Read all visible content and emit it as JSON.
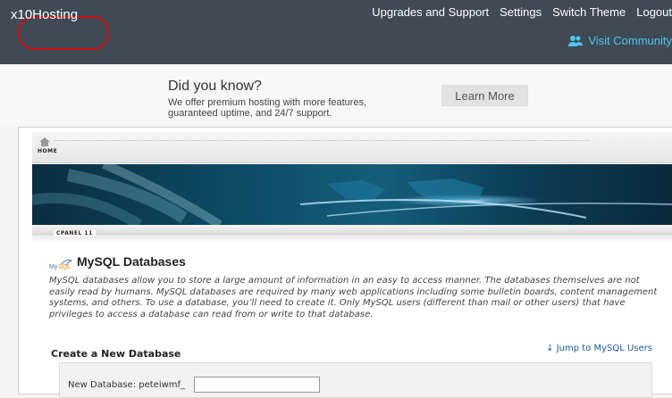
{
  "header": {
    "logo": "x10Hosting",
    "nav": [
      "Upgrades and Support",
      "Settings",
      "Switch Theme",
      "Logout"
    ],
    "community": "Visit Community",
    "community_icon": "people-icon"
  },
  "promo": {
    "title": "Did you know?",
    "text": "We offer premium hosting with more features, guaranteed uptime, and 24/7 support.",
    "button": "Learn More"
  },
  "breadcrumb": {
    "home": "HOME"
  },
  "section_label": "CPANEL 11",
  "mysql": {
    "title": "MySQL Databases",
    "description": "MySQL databases allow you to store a large amount of information in an easy to access manner. The databases themselves are not easily read by humans. MySQL databases are required by many web applications including some bulletin boards, content management systems, and others. To use a database, you’ll need to create it. Only MySQL users (different than mail or other users) that have privileges to access a database can read from or write to that database.",
    "jump": "↓ Jump to MySQL Users",
    "create_title": "Create a New Database",
    "new_db_label": "New Database: peteiwmf_",
    "new_db_value": ""
  },
  "colors": {
    "topbar": "#3f4a55",
    "accent": "#4ec4f0",
    "highlight": "#d01010"
  }
}
